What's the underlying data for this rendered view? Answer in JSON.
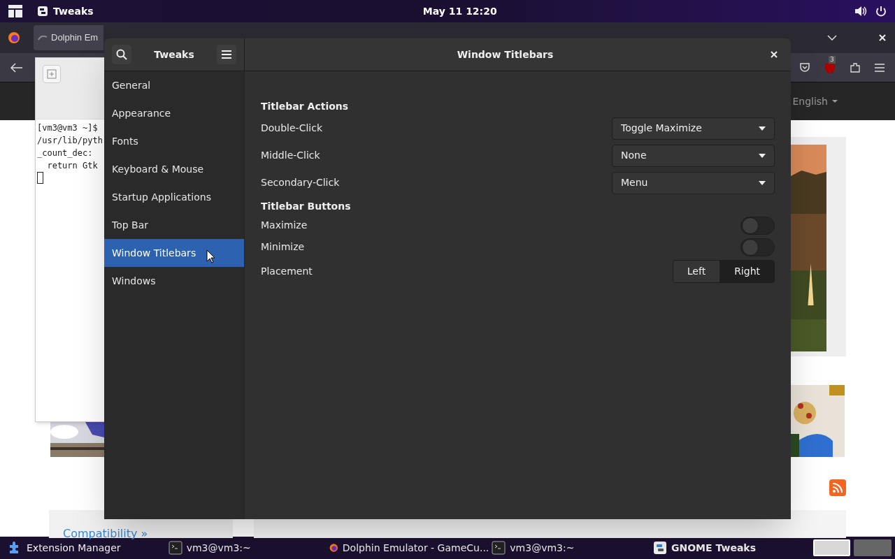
{
  "top_bar": {
    "app_menu": "Tweaks",
    "clock": "May 11  12:20"
  },
  "browser": {
    "tab_title": "Dolphin Em",
    "ublock_badge": "3",
    "language": "English",
    "card_link": "Compatibility »"
  },
  "terminal": {
    "lines": [
      "[vm3@vm3 ~]$",
      "/usr/lib/pyth",
      "_count_dec:",
      "  return Gtk"
    ]
  },
  "tweaks": {
    "title": "Tweaks",
    "page_title": "Window Titlebars",
    "sidebar": [
      {
        "label": "General",
        "selected": false
      },
      {
        "label": "Appearance",
        "selected": false
      },
      {
        "label": "Fonts",
        "selected": false
      },
      {
        "label": "Keyboard & Mouse",
        "selected": false
      },
      {
        "label": "Startup Applications",
        "selected": false
      },
      {
        "label": "Top Bar",
        "selected": false
      },
      {
        "label": "Window Titlebars",
        "selected": true
      },
      {
        "label": "Windows",
        "selected": false
      }
    ],
    "sections": [
      {
        "title": "Titlebar Actions",
        "rows": [
          {
            "kind": "dropdown",
            "label": "Double-Click",
            "value": "Toggle Maximize"
          },
          {
            "kind": "dropdown",
            "label": "Middle-Click",
            "value": "None"
          },
          {
            "kind": "dropdown",
            "label": "Secondary-Click",
            "value": "Menu"
          }
        ]
      },
      {
        "title": "Titlebar Buttons",
        "rows": [
          {
            "kind": "switch",
            "label": "Maximize",
            "on": false
          },
          {
            "kind": "switch",
            "label": "Minimize",
            "on": false
          },
          {
            "kind": "segmented",
            "label": "Placement",
            "options": [
              {
                "label": "Left",
                "selected": false
              },
              {
                "label": "Right",
                "selected": true
              }
            ]
          }
        ]
      }
    ]
  },
  "taskbar": {
    "items": [
      {
        "kind": "puzzle",
        "label": "Extension Manager",
        "selected": false
      },
      {
        "kind": "terminal",
        "label": "vm3@vm3:~",
        "selected": false
      },
      {
        "kind": "browser",
        "label": "Dolphin Emulator - GameCu...",
        "selected": false
      },
      {
        "kind": "terminal",
        "label": "vm3@vm3:~",
        "selected": false
      },
      {
        "kind": "tweaks",
        "label": "GNOME Tweaks",
        "selected": true
      }
    ],
    "workspaces": [
      {
        "selected": true
      },
      {
        "selected": false
      }
    ]
  }
}
